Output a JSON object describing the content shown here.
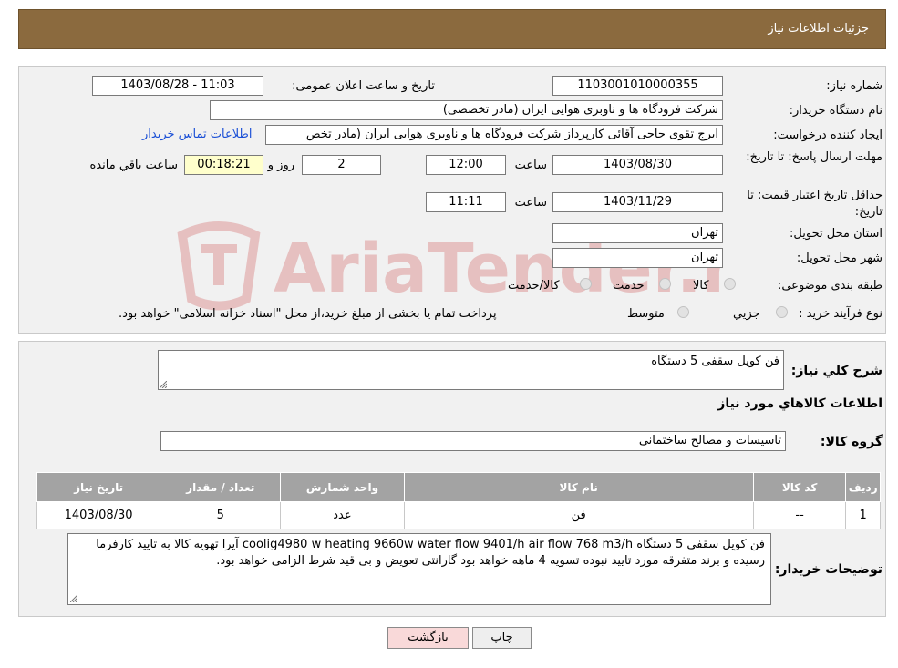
{
  "header": {
    "title": "جزئیات اطلاعات نیاز"
  },
  "labels": {
    "need_number": "شماره نیاز:",
    "announce_datetime": "تاریخ و ساعت اعلان عمومی:",
    "buyer_org": "نام دستگاه خریدار:",
    "requester": "ایجاد کننده درخواست:",
    "reply_deadline": "مهلت ارسال پاسخ: تا تاریخ:",
    "price_validity": "حداقل تاریخ اعتبار قیمت: تا تاریخ:",
    "time": "ساعت",
    "day_and": "روز و",
    "remaining": "ساعت باقي مانده",
    "province": "استان محل تحویل:",
    "city": "شهر محل تحویل:",
    "category": "طبقه بندی موضوعی:",
    "process_type": "نوع فرآیند خرید :",
    "general_desc": "شرح کلي نیاز:",
    "goods_info": "اطلاعات کالاهاي مورد نیاز",
    "goods_group": "گروه کالا:",
    "buyer_notes": "توضیحات خریدار:"
  },
  "fields": {
    "need_number": "1103001010000355",
    "announce_datetime": "1403/08/28 - 11:03",
    "buyer_org": "شرکت فرودگاه ها و ناوبری هوایی ایران (مادر تخصصی)",
    "requester": "ایرج تقوی حاجی آقائی کارپرداز شرکت فرودگاه ها و ناوبری هوایی ایران (مادر تخص",
    "contact_link": "اطلاعات تماس خریدار",
    "reply_date": "1403/08/30",
    "reply_time": "12:00",
    "reply_days": "2",
    "reply_remaining": "00:18:21",
    "validity_date": "1403/11/29",
    "validity_time": "11:11",
    "province": "تهران",
    "city": "تهران",
    "general_desc": "فن کویل سقفی 5 دستگاه",
    "goods_group": "تاسیسات و مصالح ساختمانی",
    "buyer_notes": "فن کویل سقفی 5 دستگاه coolig4980 w heating 9660w water flow 9401/h air flow 768 m3/h آیرا تهویه کالا به تایید کارفرما رسیده و برند متفرقه مورد تایید نبوده تسویه 4 ماهه خواهد بود  گارانتی تعویض و بی قید شرط الزامی خواهد بود."
  },
  "category_options": [
    "کالا",
    "خدمت",
    "کالا/خدمت"
  ],
  "process_options": [
    "جزيي",
    "متوسط"
  ],
  "process_note": "پرداخت تمام یا بخشی از مبلغ خرید،از محل \"اسناد خزانه اسلامی\" خواهد بود.",
  "table": {
    "headers": [
      "ردیف",
      "کد کالا",
      "نام کالا",
      "واحد شمارش",
      "تعداد / مقدار",
      "تاریخ نیاز"
    ],
    "rows": [
      [
        "1",
        "--",
        "فن",
        "عدد",
        "5",
        "1403/08/30"
      ]
    ]
  },
  "buttons": {
    "print": "چاپ",
    "back": "بازگشت"
  },
  "watermark": {
    "text": "AriaTender.neT"
  },
  "colors": {
    "header": "#8b6a3e",
    "table_header": "#a3a3a3",
    "link": "#1a4fd6",
    "back_button": "#f9d9d9",
    "print_button": "#eeeeee",
    "watermark": "#c01818"
  }
}
